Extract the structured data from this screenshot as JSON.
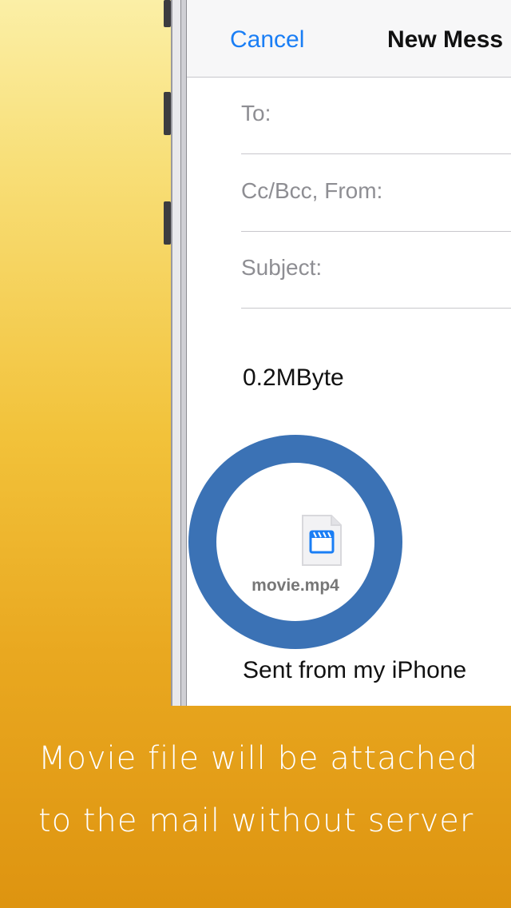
{
  "navbar": {
    "cancel_label": "Cancel",
    "title": "New Mess"
  },
  "fields": {
    "to_label": "To:",
    "ccbcc_label": "Cc/Bcc, From:",
    "subject_label": "Subject:"
  },
  "body": {
    "size_text": "0.2MByte",
    "signature": "Sent from my iPhone"
  },
  "attachment": {
    "file_name": "movie.mp4",
    "icon": "movie-file-icon"
  },
  "caption": {
    "line1": "Movie file will be attached",
    "line2": "to the mail without server"
  },
  "colors": {
    "accent_blue": "#1a7ef5",
    "highlight_ring": "#3b72b5",
    "background_top": "#fbefa6",
    "background_bottom": "#de9410"
  }
}
